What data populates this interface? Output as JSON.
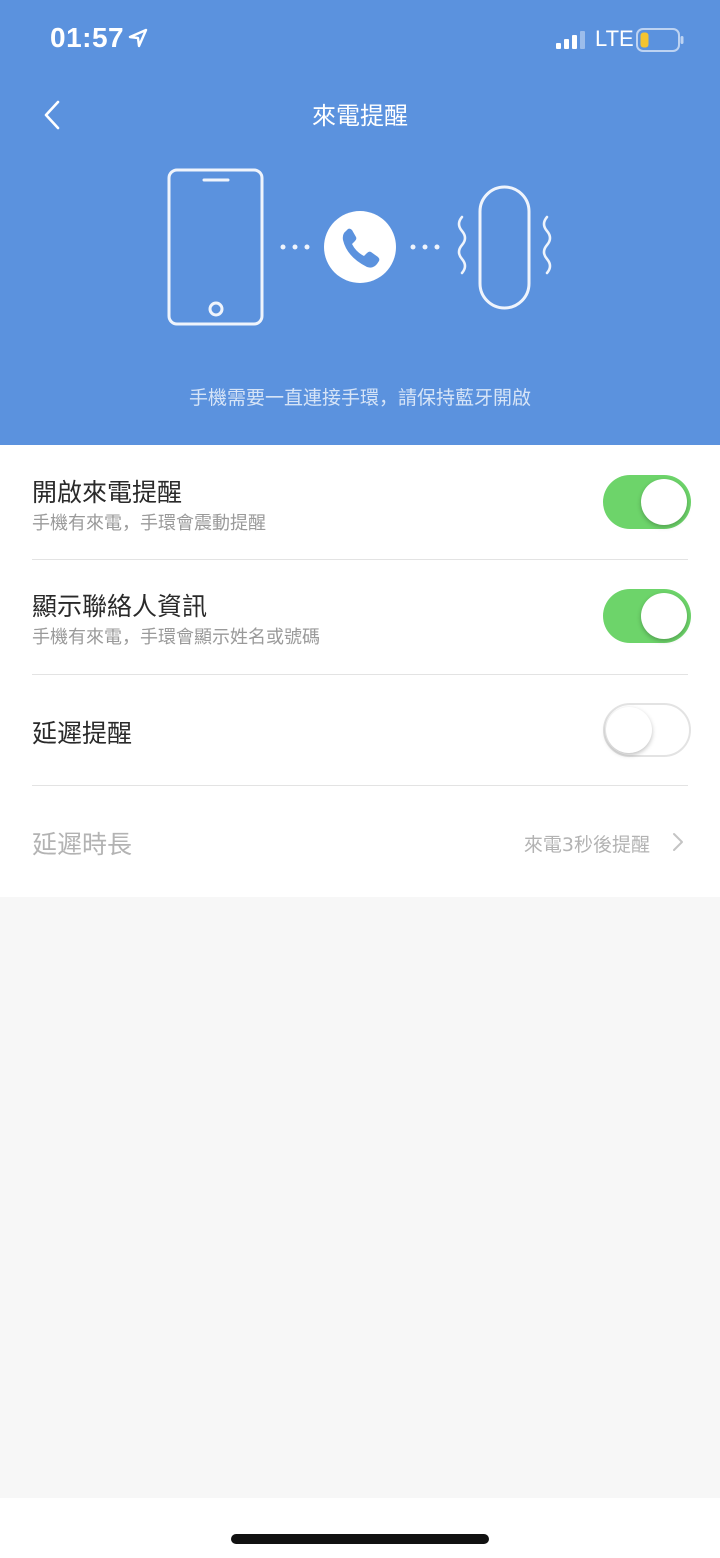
{
  "status_bar": {
    "time": "01:57",
    "network": "LTE",
    "battery_color": "#f4c430"
  },
  "header": {
    "title": "來電提醒",
    "hint": "手機需要一直連接手環，請保持藍牙開啟",
    "background": "#5b92de"
  },
  "settings": {
    "incoming_call": {
      "label": "開啟來電提醒",
      "subtitle": "手機有來電，手環會震動提醒",
      "enabled": true
    },
    "contact_info": {
      "label": "顯示聯絡人資訊",
      "subtitle": "手機有來電，手環會顯示姓名或號碼",
      "enabled": true
    },
    "delay_reminder": {
      "label": "延遲提醒",
      "enabled": false
    },
    "delay_duration": {
      "label": "延遲時長",
      "value": "來電3秒後提醒"
    }
  },
  "colors": {
    "toggle_on": "#6dd46a",
    "accent": "#5b92de"
  }
}
